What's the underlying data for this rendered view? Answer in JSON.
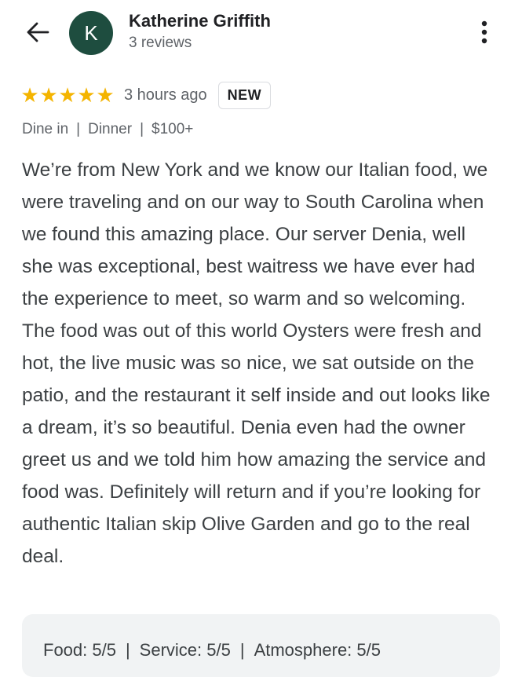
{
  "header": {
    "avatar_letter": "K",
    "author_name": "Katherine Griffith",
    "author_reviews": "3 reviews"
  },
  "rating": {
    "stars": 5,
    "max_stars": 5,
    "time_ago": "3 hours ago",
    "badge": "NEW"
  },
  "meta": {
    "dining": "Dine in",
    "meal": "Dinner",
    "price": "$100+",
    "separator": "|"
  },
  "review": {
    "text": "We’re from New York and we know our Italian food, we were traveling and on our way to South Carolina when we found this amazing place. Our server Denia, well she was exceptional, best waitress we have ever had the experience to meet, so warm and so welcoming. The food was out of this world Oysters were fresh and hot, the live music was so nice, we sat outside on the patio, and the restaurant it self inside and out looks like a dream, it’s so beautiful. Denia even had the owner greet us and we told him how amazing the service and food was. Definitely will return and if you’re looking for authentic Italian skip Olive Garden and go to the real deal."
  },
  "ratings": {
    "food": "Food: 5/5",
    "service": "Service: 5/5",
    "atmosphere": "Atmosphere: 5/5",
    "separator": "|"
  },
  "colors": {
    "avatar_bg": "#1e4d3f",
    "star": "#f4b400",
    "card_bg": "#f1f3f4"
  },
  "icons": {
    "back": "arrow-back-icon",
    "more": "more-vert-icon",
    "star": "star-icon"
  }
}
